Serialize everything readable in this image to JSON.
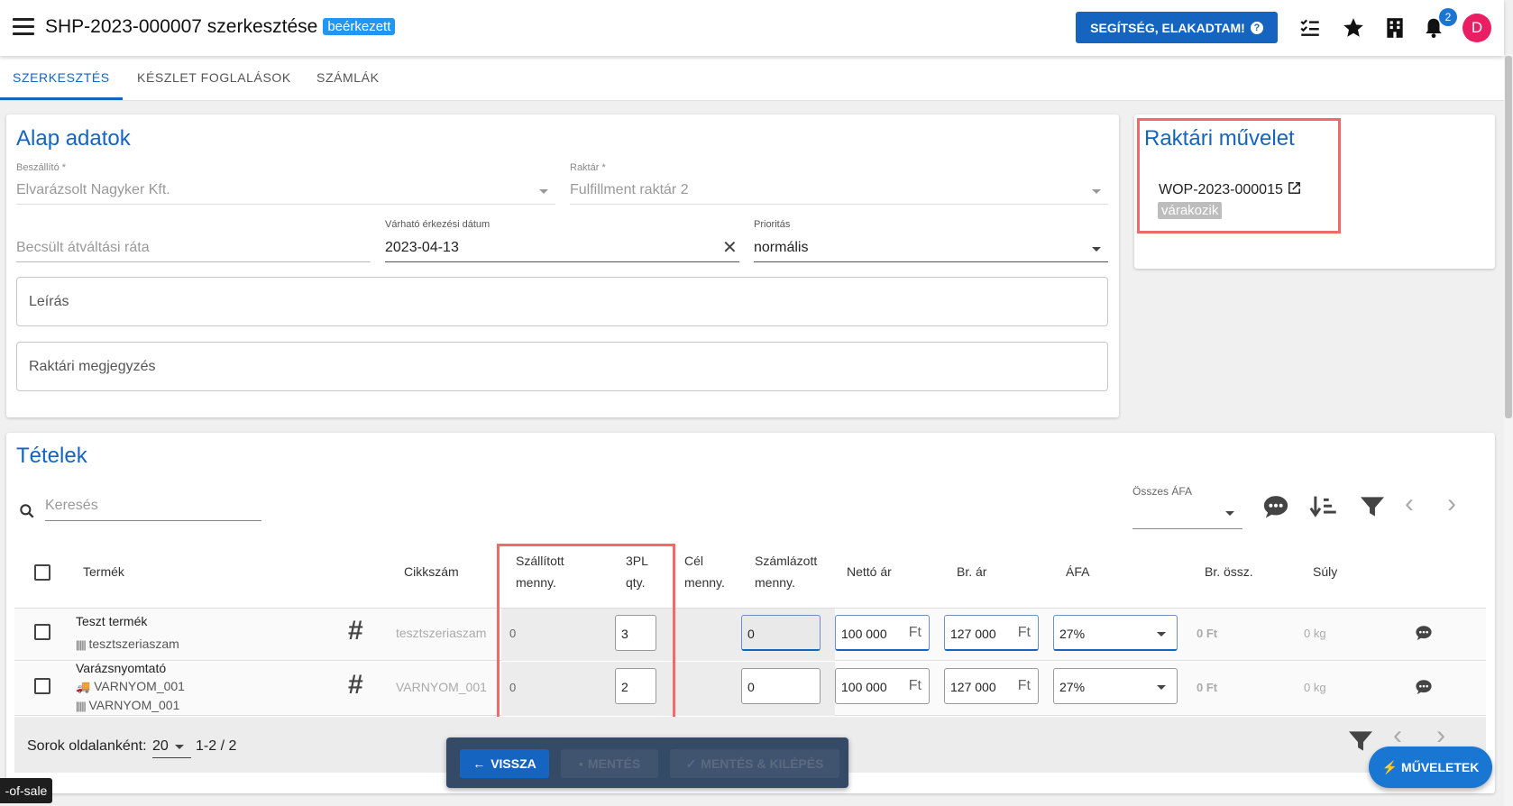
{
  "header": {
    "title": "SHP-2023-000007 szerkesztése",
    "status": "beérkezett",
    "help_label": "SEGÍTSÉG, ELAKADTAM!",
    "notification_count": "2",
    "avatar_letter": "D"
  },
  "tabs": [
    {
      "label": "SZERKESZTÉS"
    },
    {
      "label": "KÉSZLET FOGLALÁSOK"
    },
    {
      "label": "SZÁMLÁK"
    }
  ],
  "basic": {
    "title": "Alap adatok",
    "supplier_label": "Beszállító *",
    "supplier_value": "Elvarázsolt Nagyker Kft.",
    "warehouse_label": "Raktár *",
    "warehouse_value": "Fulfillment raktár 2",
    "rate_placeholder": "Becsült átváltási ráta",
    "arrival_label": "Várható érkezési dátum",
    "arrival_value": "2023-04-13",
    "priority_label": "Prioritás",
    "priority_value": "normális",
    "description_placeholder": "Leírás",
    "warehouse_note_placeholder": "Raktári megjegyzés"
  },
  "warehouse_op": {
    "title": "Raktári művelet",
    "id": "WOP-2023-000015",
    "status": "várakozik"
  },
  "items": {
    "title": "Tételek",
    "search_placeholder": "Keresés",
    "vat_filter_label": "Összes ÁFA",
    "columns": {
      "product": "Termék",
      "sku": "Cikkszám",
      "shipped_1": "Szállított",
      "shipped_2": "menny.",
      "tpl_1": "3PL",
      "tpl_2": "qty.",
      "target_1": "Cél",
      "target_2": "menny.",
      "invoiced_1": "Számlázott",
      "invoiced_2": "menny.",
      "net": "Nettó ár",
      "gross": "Br. ár",
      "vat": "ÁFA",
      "gross_total": "Br. össz.",
      "weight": "Súly"
    },
    "rows": [
      {
        "name": "Teszt termék",
        "barcode": "tesztszeriaszam",
        "sku": "tesztszeriaszam",
        "shipped": "0",
        "tpl_qty": "3",
        "invoiced": "0",
        "net": "100 000",
        "gross": "127 000",
        "currency": "Ft",
        "vat": "27%",
        "gross_total": "0 Ft",
        "weight": "0 kg"
      },
      {
        "name": "Varázsnyomtató",
        "supplier_code": "VARNYOM_001",
        "barcode": "VARNYOM_001",
        "sku": "VARNYOM_001",
        "shipped": "0",
        "tpl_qty": "2",
        "invoiced": "0",
        "net": "100 000",
        "gross": "127 000",
        "currency": "Ft",
        "vat": "27%",
        "gross_total": "0 Ft",
        "weight": "0 kg"
      }
    ],
    "rows_per_page_label": "Sorok oldalanként:",
    "rows_per_page": "20",
    "range": "1-2 / 2"
  },
  "actions": {
    "back": "VISSZA",
    "save": "MENTÉS",
    "save_exit": "MENTÉS & KILÉPÉS",
    "operations": "MŰVELETEK"
  },
  "tooltip": "-of-sale",
  "colors": {
    "primary": "#1565c0",
    "status_blue": "#2196f3",
    "highlight_red": "#f06a6a",
    "avatar": "#e91e63"
  }
}
